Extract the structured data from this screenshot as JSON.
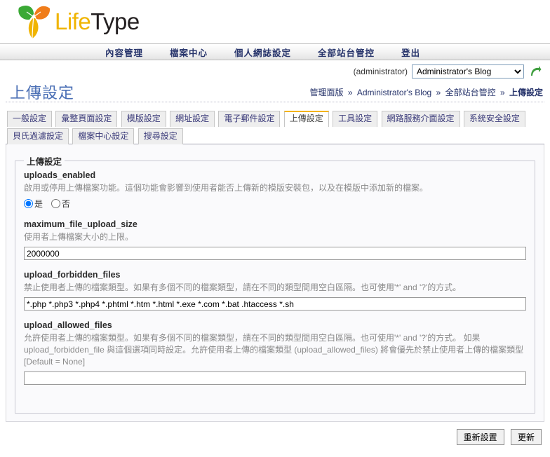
{
  "brand": {
    "name_part1": "Life",
    "name_part2": "Type",
    "leaf_green": "#3aa935",
    "leaf_orange": "#f07d1a",
    "leaf_yellow": "#f0b400"
  },
  "main_nav": {
    "items": [
      {
        "label": "內容管理"
      },
      {
        "label": "檔案中心"
      },
      {
        "label": "個人網誌設定"
      },
      {
        "label": "全部站台管控"
      },
      {
        "label": "登出"
      }
    ]
  },
  "blog_bar": {
    "admin_label": "(administrator)",
    "selected_blog": "Administrator's Blog",
    "go_icon": "curved-arrow-icon"
  },
  "header": {
    "page_title": "上傳設定"
  },
  "breadcrumb": {
    "separator": "»",
    "items": [
      {
        "label": "管理面版"
      },
      {
        "label": "Administrator's Blog"
      },
      {
        "label": "全部站台管控"
      },
      {
        "label": "上傳設定"
      }
    ]
  },
  "tabs": [
    {
      "label": "一般設定",
      "active": false
    },
    {
      "label": "彙整頁面設定",
      "active": false
    },
    {
      "label": "模版設定",
      "active": false
    },
    {
      "label": "網址設定",
      "active": false
    },
    {
      "label": "電子郵件設定",
      "active": false
    },
    {
      "label": "上傳設定",
      "active": true
    },
    {
      "label": "工具設定",
      "active": false
    },
    {
      "label": "網路服務介面設定",
      "active": false
    },
    {
      "label": "系統安全設定",
      "active": false
    },
    {
      "label": "貝氏過濾設定",
      "active": false
    },
    {
      "label": "檔案中心設定",
      "active": false
    },
    {
      "label": "搜尋設定",
      "active": false
    }
  ],
  "form": {
    "legend": "上傳設定",
    "fields": [
      {
        "name": "uploads_enabled",
        "description": "啟用或停用上傳檔案功能。這個功能會影響到使用者能否上傳新的模版安裝包，以及在模版中添加新的檔案。",
        "type": "radio",
        "options": [
          {
            "label": "是",
            "checked": true
          },
          {
            "label": "否",
            "checked": false
          }
        ]
      },
      {
        "name": "maximum_file_upload_size",
        "description": "使用者上傳檔案大小的上限。",
        "type": "text",
        "value": "2000000"
      },
      {
        "name": "upload_forbidden_files",
        "description": "禁止使用者上傳的檔案類型。如果有多個不同的檔案類型，請在不同的類型間用空白區隔。也可使用'*' and '?'的方式。",
        "type": "text",
        "value": "*.php *.php3 *.php4 *.phtml *.htm *.html *.exe *.com *.bat .htaccess *.sh"
      },
      {
        "name": "upload_allowed_files",
        "description": "允許使用者上傳的檔案類型。如果有多個不同的檔案類型，請在不同的類型間用空白區隔。也可使用'*' and '?'的方式。 如果 upload_forbidden_file 與這個選項同時設定。允許使用者上傳的檔案類型 (upload_allowed_files) 將會優先於禁止使用者上傳的檔案類型 [Default = None]",
        "type": "text",
        "value": ""
      }
    ]
  },
  "footer": {
    "reset_label": "重新設置",
    "update_label": "更新"
  }
}
